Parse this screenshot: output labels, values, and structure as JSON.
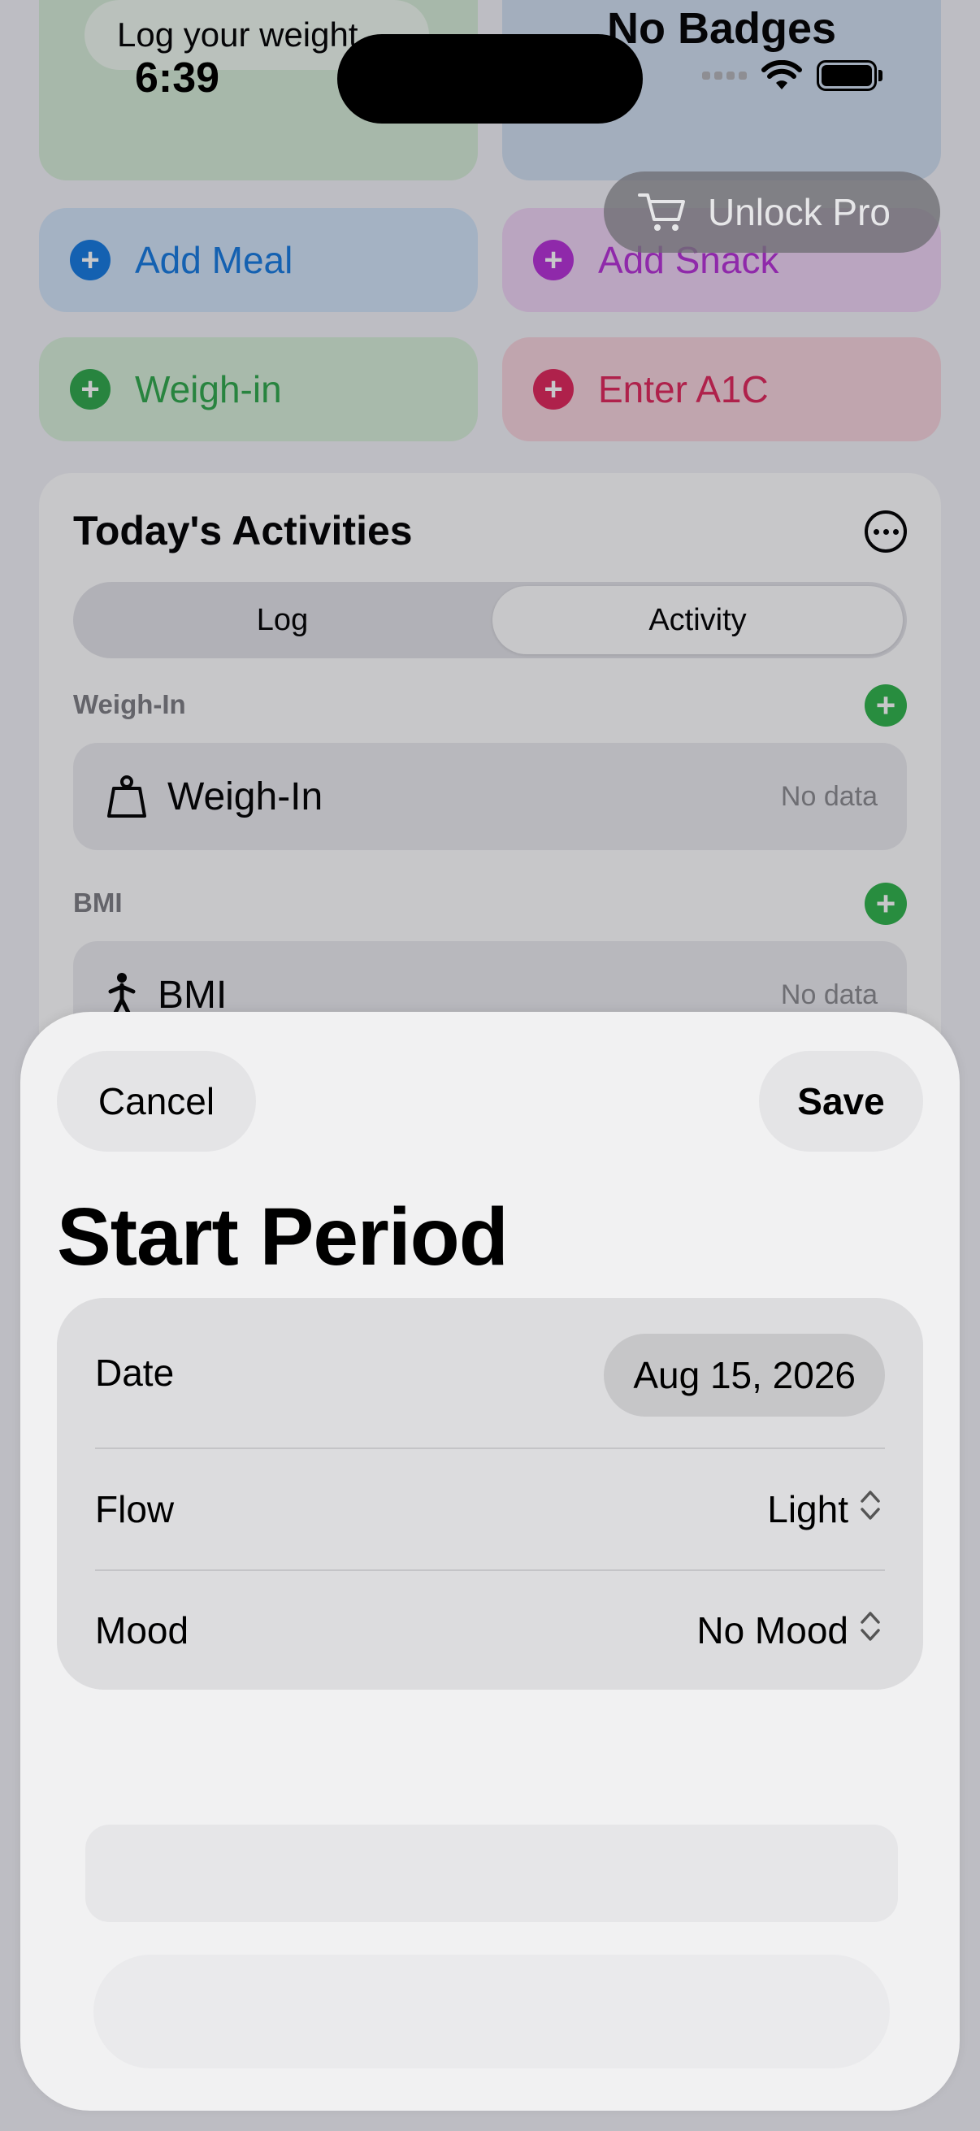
{
  "status_bar": {
    "time": "6:39"
  },
  "background": {
    "top_left_tile_text": "Log your weight",
    "top_right_tile_text": "No Badges",
    "unlock_pro_label": "Unlock Pro",
    "quick_actions": [
      {
        "label": "Add Meal",
        "color": "#1479e0"
      },
      {
        "label": "Add Snack",
        "color": "#b630d6"
      },
      {
        "label": "Weigh-in",
        "color": "#2ea84a"
      },
      {
        "label": "Enter A1C",
        "color": "#e0265a"
      }
    ],
    "activities": {
      "title": "Today's Activities",
      "tabs": [
        {
          "label": "Log",
          "selected": false
        },
        {
          "label": "Activity",
          "selected": true
        }
      ],
      "sections": [
        {
          "title": "Weigh-In",
          "row_label": "Weigh-In",
          "row_value": "No data"
        },
        {
          "title": "BMI",
          "row_label": "BMI",
          "row_value": "No data"
        }
      ]
    }
  },
  "sheet": {
    "cancel_label": "Cancel",
    "save_label": "Save",
    "title": "Start Period",
    "fields": {
      "date_label": "Date",
      "date_value": "Aug 15, 2026",
      "flow_label": "Flow",
      "flow_value": "Light",
      "mood_label": "Mood",
      "mood_value": "No Mood"
    }
  }
}
